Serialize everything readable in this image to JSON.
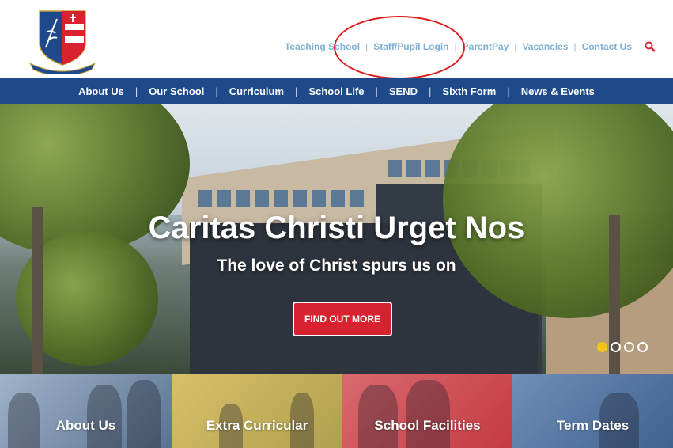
{
  "header": {
    "crest_motto": "Caritas Christi Urget Nos",
    "toplinks": [
      {
        "label": "Teaching School"
      },
      {
        "label": "Staff/Pupil Login"
      },
      {
        "label": "ParentPay"
      },
      {
        "label": "Vacancies"
      },
      {
        "label": "Contact Us"
      }
    ],
    "search_icon": "search-icon"
  },
  "nav": {
    "items": [
      {
        "label": "About Us"
      },
      {
        "label": "Our School"
      },
      {
        "label": "Curriculum"
      },
      {
        "label": "School Life"
      },
      {
        "label": "SEND"
      },
      {
        "label": "Sixth Form"
      },
      {
        "label": "News & Events"
      }
    ]
  },
  "hero": {
    "title": "Caritas Christi Urget Nos",
    "subtitle": "The love of Christ spurs us on",
    "cta_label": "FIND OUT MORE",
    "slide_count": 4,
    "active_slide": 1
  },
  "tiles": [
    {
      "label": "About Us"
    },
    {
      "label": "Extra Curricular"
    },
    {
      "label": "School Facilities"
    },
    {
      "label": "Term Dates"
    }
  ],
  "colors": {
    "nav_bg": "#1e4a8c",
    "toplink": "#7fb0d6",
    "cta": "#d8222f",
    "annotation_oval": "#e01b1b",
    "active_dot": "#f0c419"
  }
}
